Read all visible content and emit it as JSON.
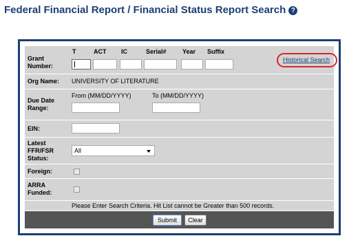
{
  "page": {
    "title": "Federal Financial Report / Financial Status Report Search",
    "help_icon": "?"
  },
  "grant_number": {
    "label": "Grant Number:",
    "fields": {
      "type_label": "T",
      "act_label": "ACT",
      "ic_label": "IC",
      "serial_label": "Serial#",
      "year_label": "Year",
      "suffix_label": "Suffix"
    },
    "historical_link": "Historical Search"
  },
  "org_name": {
    "label": "Org Name:",
    "value": "UNIVERSITY OF LITERATURE"
  },
  "due_date": {
    "label": "Due Date Range:",
    "from_label": "From (MM/DD/YYYY)",
    "to_label": "To (MM/DD/YYYY)"
  },
  "ein": {
    "label": "EIN:"
  },
  "status": {
    "label": "Latest FFR/FSR Status:",
    "selected": "All"
  },
  "foreign": {
    "label": "Foreign:"
  },
  "arra": {
    "label": "ARRA Funded:"
  },
  "message": "Please Enter Search Criteria. Hit List cannot be Greater than 500 records.",
  "buttons": {
    "submit": "Submit",
    "clear": "Clear"
  },
  "colors": {
    "accent": "#1b3f73",
    "highlight": "#d9232e",
    "panel": "#d4d4d4",
    "bar": "#555555"
  }
}
